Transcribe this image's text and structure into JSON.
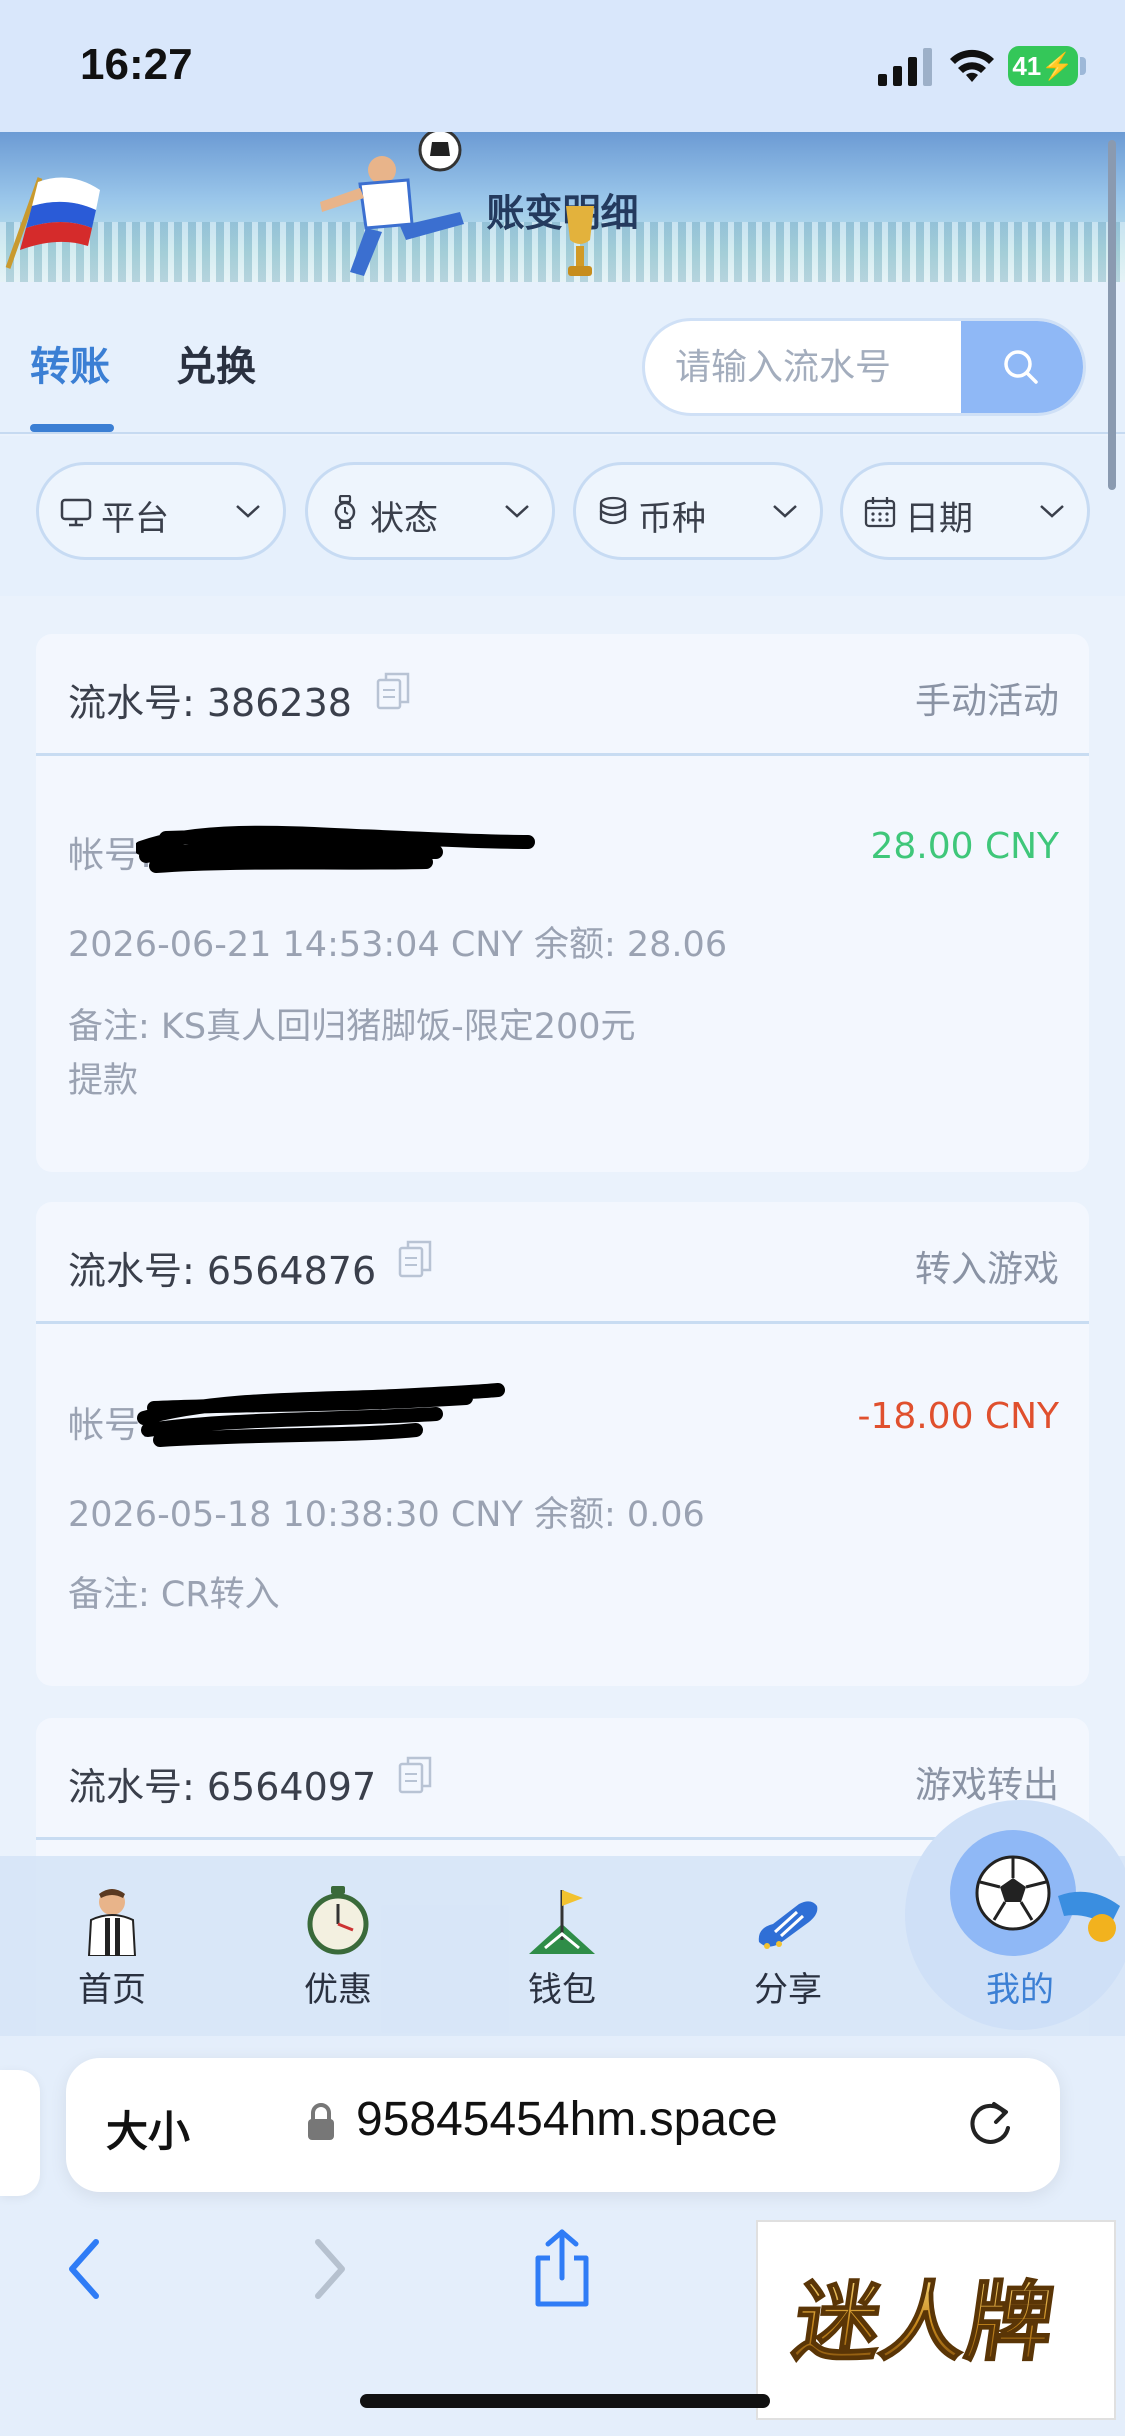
{
  "status_bar": {
    "time": "16:27",
    "battery": "41"
  },
  "header": {
    "title": "账变明细"
  },
  "tabs": [
    {
      "label": "转账",
      "active": true
    },
    {
      "label": "兑换",
      "active": false
    }
  ],
  "search": {
    "placeholder": "请输入流水号"
  },
  "filters": [
    {
      "label": "平台",
      "icon": "monitor-icon"
    },
    {
      "label": "状态",
      "icon": "watch-icon"
    },
    {
      "label": "币种",
      "icon": "coins-icon"
    },
    {
      "label": "日期",
      "icon": "calendar-icon"
    }
  ],
  "records": [
    {
      "serial_label": "流水号: 386238",
      "type": "手动活动",
      "account_label": "帐号:",
      "amount": "28.00 CNY",
      "amount_color": "#3fc77a",
      "meta": "2026-06-21 14:53:04 CNY 余额: 28.06",
      "note_line1": "备注: KS真人回归猪脚饭-限定200元",
      "note_line2": "提款"
    },
    {
      "serial_label": "流水号: 6564876",
      "type": "转入游戏",
      "account_label": "帐号:",
      "amount": "-18.00 CNY",
      "amount_color": "#e0502e",
      "meta": "2026-05-18 10:38:30 CNY 余额: 0.06",
      "note_line1": "备注: CR转入"
    },
    {
      "serial_label": "流水号: 6564097",
      "type": "游戏转出"
    }
  ],
  "bottom_nav": [
    {
      "label": "首页",
      "icon": "footballer-icon"
    },
    {
      "label": "优惠",
      "icon": "stopwatch-icon"
    },
    {
      "label": "钱包",
      "icon": "flag-icon"
    },
    {
      "label": "分享",
      "icon": "boot-icon"
    },
    {
      "label": "我的",
      "icon": "football-icon",
      "active": true
    }
  ],
  "browser": {
    "aa_label": "大小",
    "url": "95845454hm.space"
  },
  "watermark": {
    "text": "迷人牌"
  },
  "colors": {
    "accent": "#3b7fd4",
    "positive": "#3fc77a",
    "negative": "#e0502e"
  }
}
